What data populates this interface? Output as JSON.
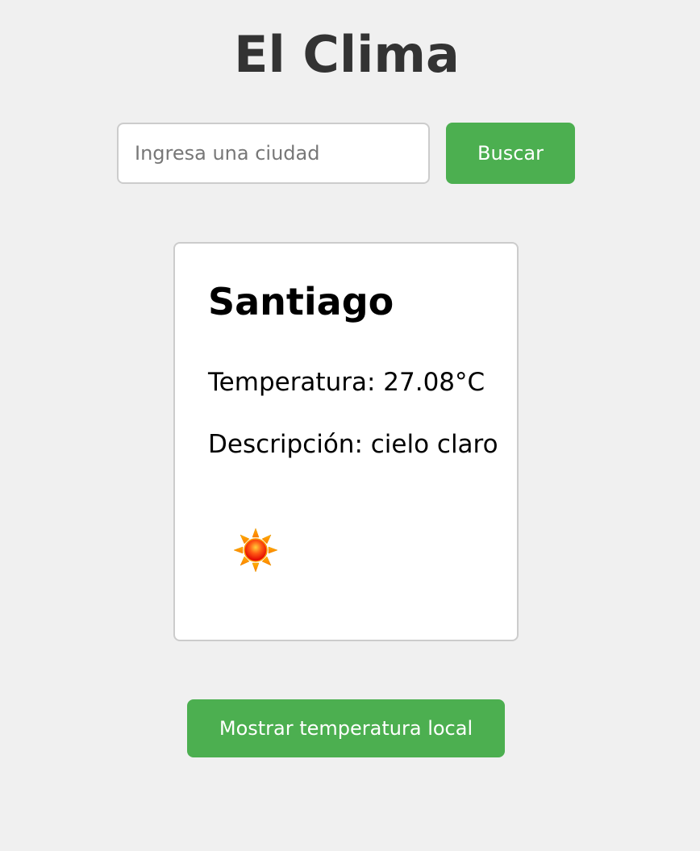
{
  "app": {
    "title": "El Clima"
  },
  "search": {
    "placeholder": "Ingresa una ciudad",
    "value": "",
    "button_label": "Buscar"
  },
  "weather": {
    "city": "Santiago",
    "temperature_text": "Temperatura: 27.08°C",
    "description_text": "Descripción: cielo claro",
    "icon": "sun-icon"
  },
  "local": {
    "button_label": "Mostrar temperatura local"
  },
  "colors": {
    "accent": "#4caf50",
    "background": "#f0f0f0",
    "card": "#ffffff",
    "title": "#333333"
  }
}
